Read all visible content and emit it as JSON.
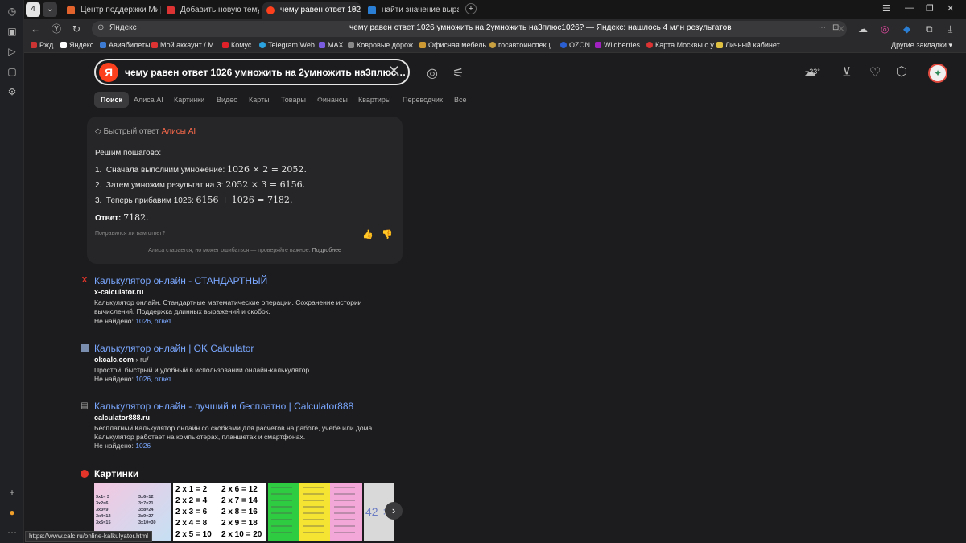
{
  "tabs": {
    "count_badge": "4",
    "items": [
      {
        "title": "Центр поддержки Мир т"
      },
      {
        "title": "Добавить новую тему - С"
      },
      {
        "title": "чему равен ответ 1026"
      },
      {
        "title": "найти значение выраже"
      }
    ]
  },
  "address": {
    "site": "Яндекс",
    "url": "чему равен ответ 1026 умножить на 2умножить на3плюс1026? — Яндекс: нашлось 4 млн результатов"
  },
  "bookmarks": {
    "items": [
      "Ржд",
      "Яндекс",
      "Авиабилеты",
      "Мой аккаунт / М..",
      "Комус",
      "Telegram Web",
      "MAX",
      "Ковровые дорож..",
      "Офисная мебель..",
      "госавтоинспекц..",
      "OZON",
      "Wildberries",
      "Карта Москвы с у..",
      "Личный кабинет .."
    ],
    "other": "Другие закладки"
  },
  "search": {
    "query": "чему равен ответ 1026 умножить на 2умножить на3плюс…",
    "logo": "Я"
  },
  "weather": "+23°",
  "nav": [
    "Поиск",
    "Алиса AI",
    "Картинки",
    "Видео",
    "Карты",
    "Товары",
    "Финансы",
    "Квартиры",
    "Переводчик",
    "Все"
  ],
  "alice": {
    "header_prefix": "Быстрый ответ",
    "header_accent": "Алисы AI",
    "intro": "Решим пошагово:",
    "steps": [
      {
        "num": "1.",
        "text": "Сначала выполним умножение: ",
        "math": "1026 × 2 = 2052",
        "tail": "."
      },
      {
        "num": "2.",
        "text": "Затем умножим результат на 3: ",
        "math": "2052 × 3 = 6156",
        "tail": "."
      },
      {
        "num": "3.",
        "text": "Теперь прибавим 1026: ",
        "math": "6156 + 1026 = 7182",
        "tail": "."
      }
    ],
    "answer_label": "Ответ:",
    "answer_value": "7182",
    "answer_tail": ".",
    "feedback_q": "Понравился ли вам ответ?",
    "disclaimer": "Алиса старается, но может ошибаться — проверяйте важное.",
    "disclaimer_link": "Подробнее"
  },
  "results": [
    {
      "title": "Калькулятор онлайн - СТАНДАРТНЫЙ",
      "host": "x-calculator.ru",
      "path": "",
      "snippet": "Калькулятор онлайн. Стандартные математические операции. Сохранение истории вычислений. Поддержка длинных выражений и скобок.",
      "missing_label": "Не найдено:",
      "missing": "1026, ответ"
    },
    {
      "title": "Калькулятор онлайн | OK Calculator",
      "host": "okcalc.com",
      "path": " › ru/",
      "snippet": "Простой, быстрый и удобный в использовании онлайн-калькулятор.",
      "missing_label": "Не найдено:",
      "missing": "1026, ответ"
    },
    {
      "title": "Калькулятор онлайн - лучший и бесплатно | Calculator888",
      "host": "calculator888.ru",
      "path": "",
      "snippet": "Бесплатный Калькулятор онлайн со скобками для расчетов на работе, учёбе или дома. Калькулятор работает на компьютерах, планшетах и смартфонах.",
      "missing_label": "Не найдено:",
      "missing": "1026"
    }
  ],
  "images_heading": "Картинки",
  "thumb1": {
    "left": [
      "3x1= 3",
      "3x2=6",
      "3x3=9",
      "3x4=12",
      "3x5=15"
    ],
    "right": [
      "3x6=12",
      "3x7=21",
      "3x8=24",
      "3x9=27",
      "3x10=30"
    ]
  },
  "thumb2": {
    "left": [
      "2 x 1 = 2",
      "2 x 2 = 4",
      "2 x 3 = 6",
      "2 x 4 = 8",
      "2 x 5 = 10"
    ],
    "right": [
      "2 x 6 = 12",
      "2 x 7 = 14",
      "2 x 8 = 16",
      "2 x 9 = 18",
      "2 x 10 = 20"
    ]
  },
  "thumb5_text": "42 ÷",
  "status_url": "https://www.calc.ru/online-kalkulyator.html",
  "colors": {
    "accent": "#fc3f1d",
    "link": "#7aa7ff",
    "bg": "#1c1c1e"
  }
}
